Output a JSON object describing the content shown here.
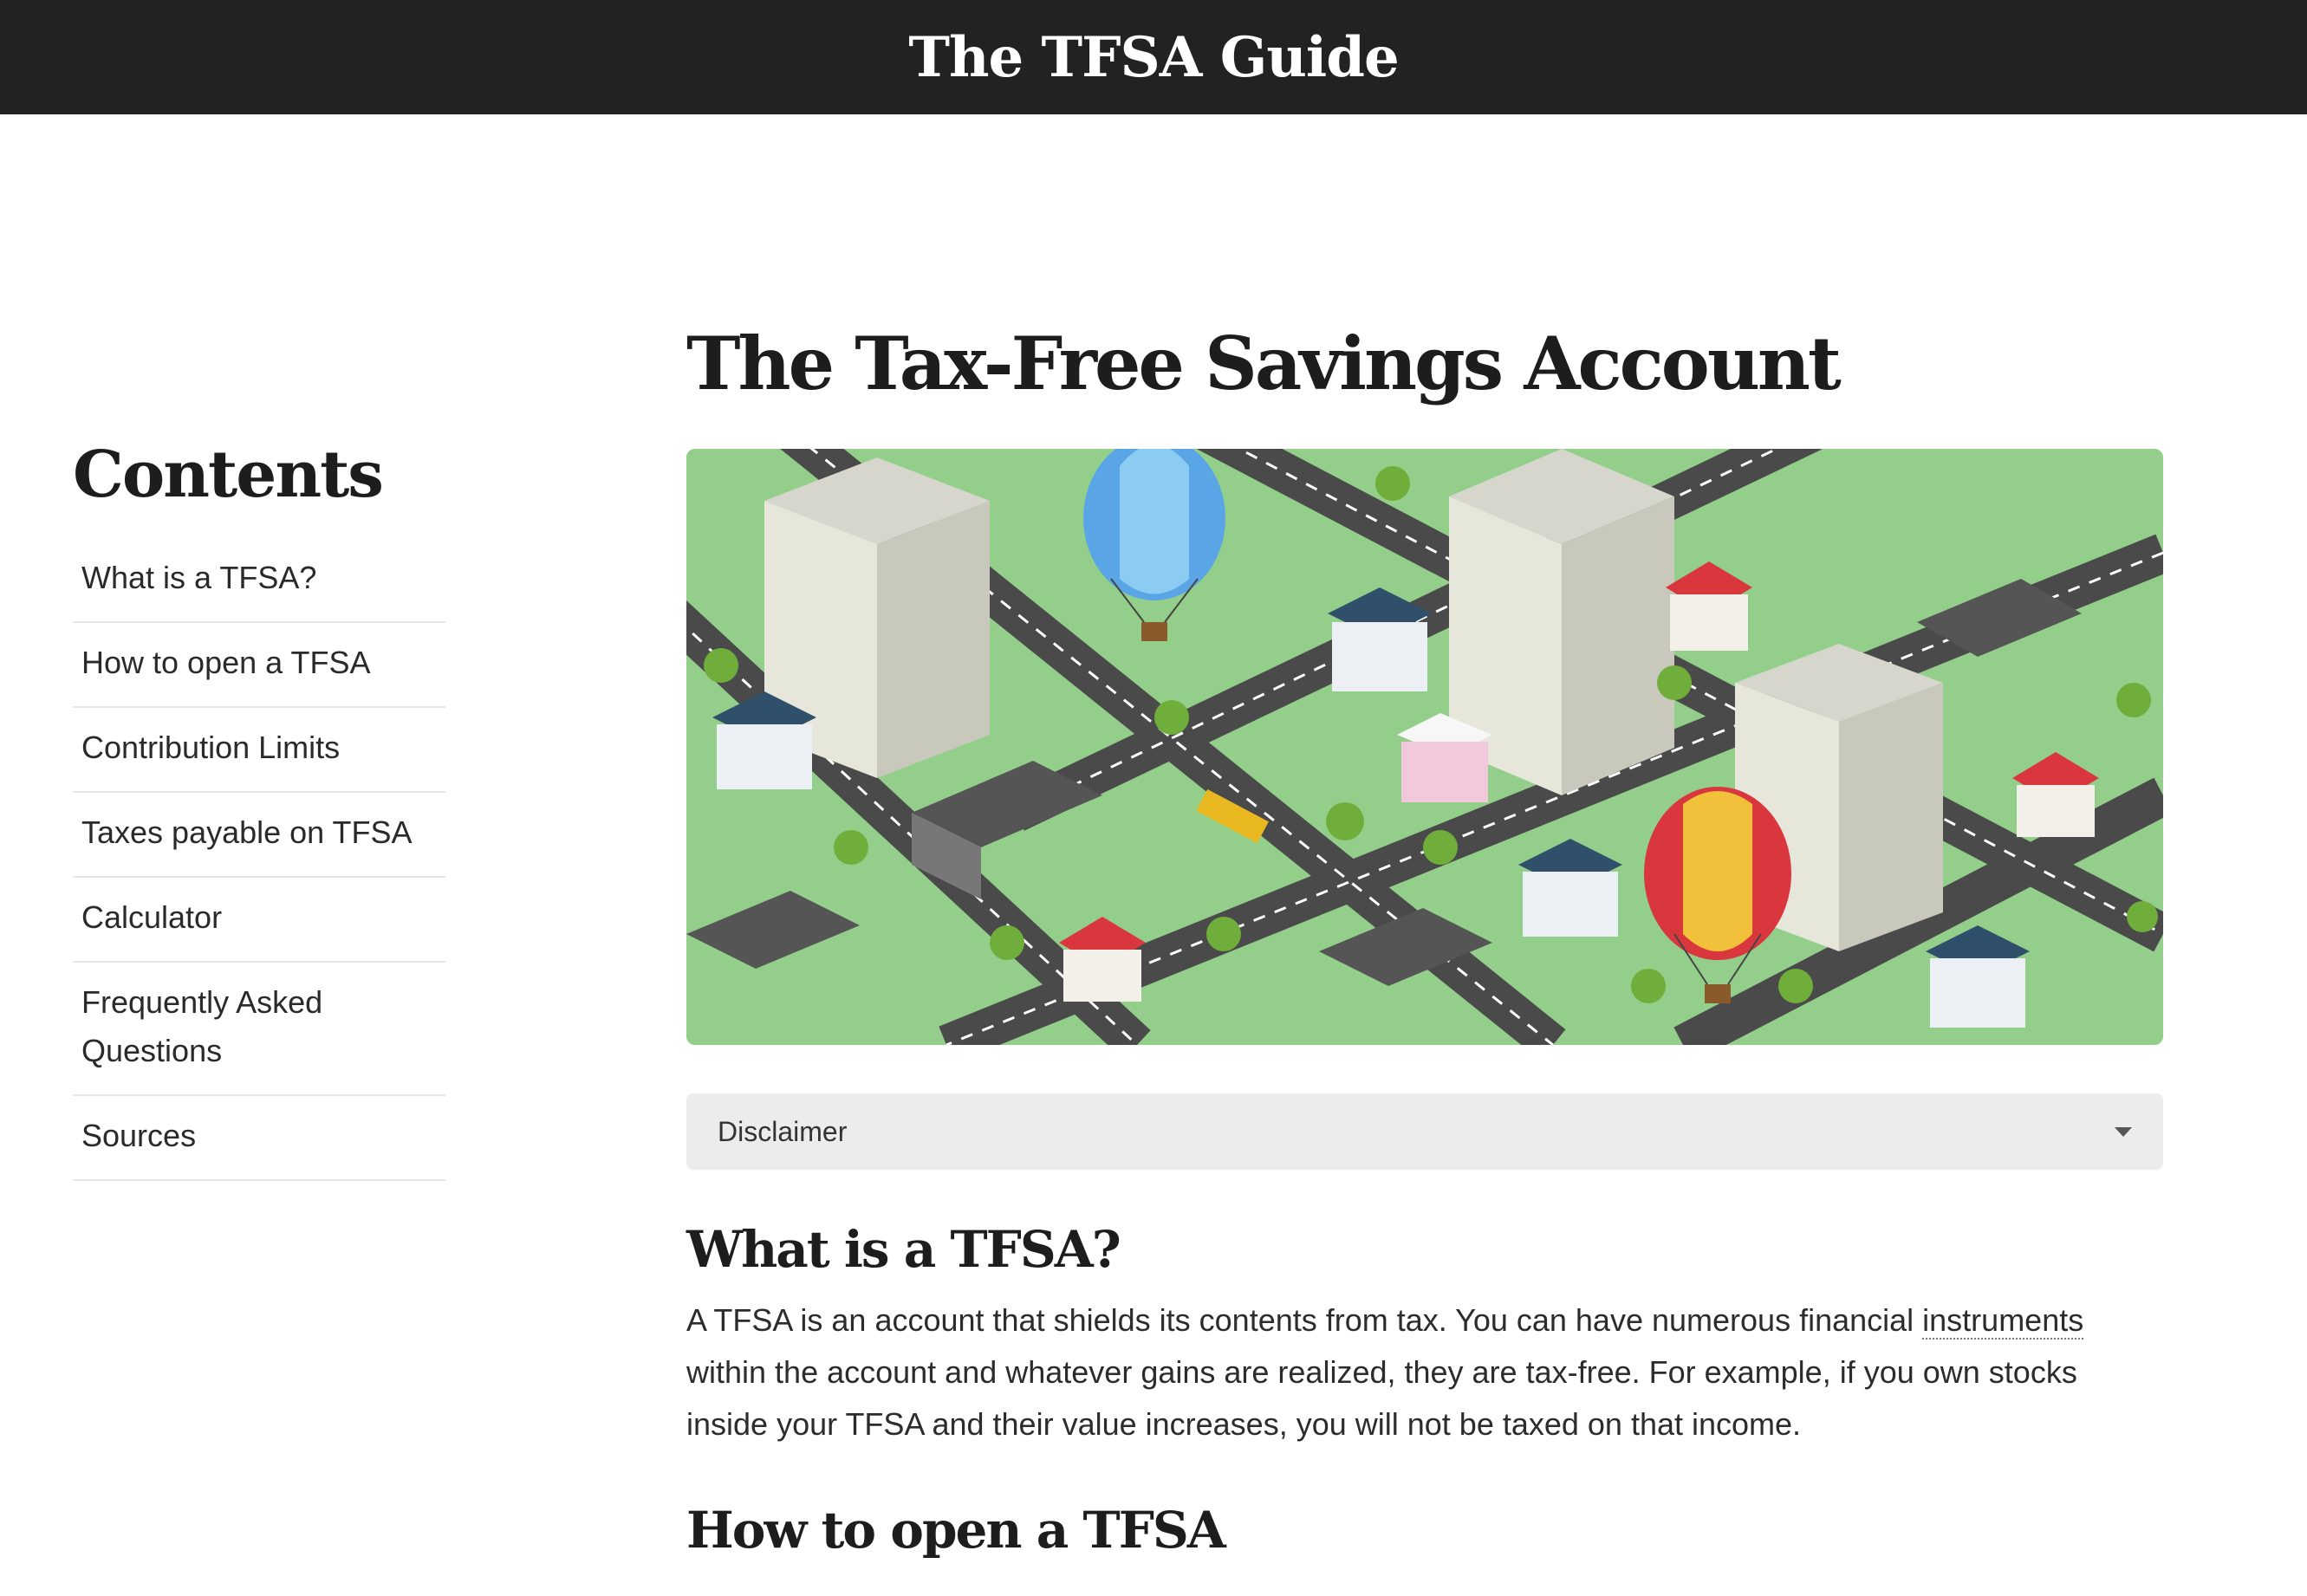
{
  "header": {
    "site_title": "The TFSA Guide"
  },
  "sidebar": {
    "heading": "Contents",
    "items": [
      {
        "label": "What is a TFSA?"
      },
      {
        "label": "How to open a TFSA"
      },
      {
        "label": "Contribution Limits"
      },
      {
        "label": "Taxes payable on TFSA"
      },
      {
        "label": "Calculator"
      },
      {
        "label": "Frequently Asked Questions"
      },
      {
        "label": "Sources"
      }
    ]
  },
  "main": {
    "title": "The Tax-Free Savings Account",
    "hero_icon": "isometric-city-illustration",
    "disclaimer": {
      "label": "Disclaimer",
      "icon": "caret-down-icon"
    },
    "section1": {
      "heading": "What is a TFSA?",
      "text_before": "A TFSA is an account that shields its contents from tax. You can have numerous financial ",
      "link": "instruments",
      "text_after": " within the account and whatever gains are realized, they are tax-free. For example, if you own stocks inside your TFSA and their value increases, you will not be taxed on that income."
    },
    "section2": {
      "heading": "How to open a TFSA"
    }
  }
}
